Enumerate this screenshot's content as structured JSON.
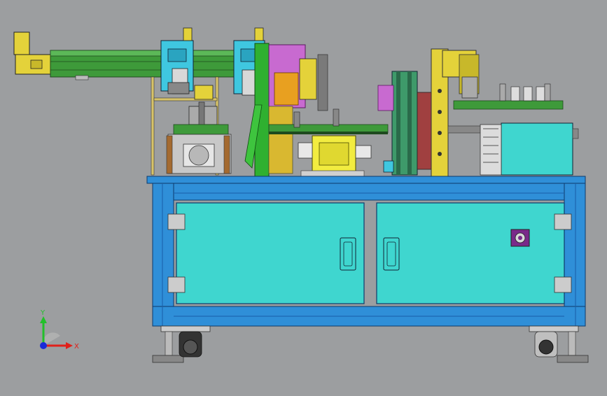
{
  "viewport": {
    "background": "#9c9ea0"
  },
  "triad": {
    "x_label": "X",
    "y_label": "Y",
    "x_color": "#e0201a",
    "y_color": "#22c02a",
    "z_color": "#1a2ad8"
  },
  "colors": {
    "frame_blue": "#2f8fd8",
    "frame_blue_dark": "#1a5ea8",
    "panel_cyan": "#3fd6cf",
    "conveyor_green": "#3e9a3a",
    "actuator_yellow": "#e4d23a",
    "module_cyan": "#3fc7e0",
    "module_magenta": "#c86ad0",
    "module_orange": "#e8a020",
    "motor_yellow": "#f2ec40",
    "handle_purple": "#7a2a8a"
  },
  "icons": {
    "estop": "emergency-stop-icon",
    "triad": "coordinate-triad-icon"
  }
}
